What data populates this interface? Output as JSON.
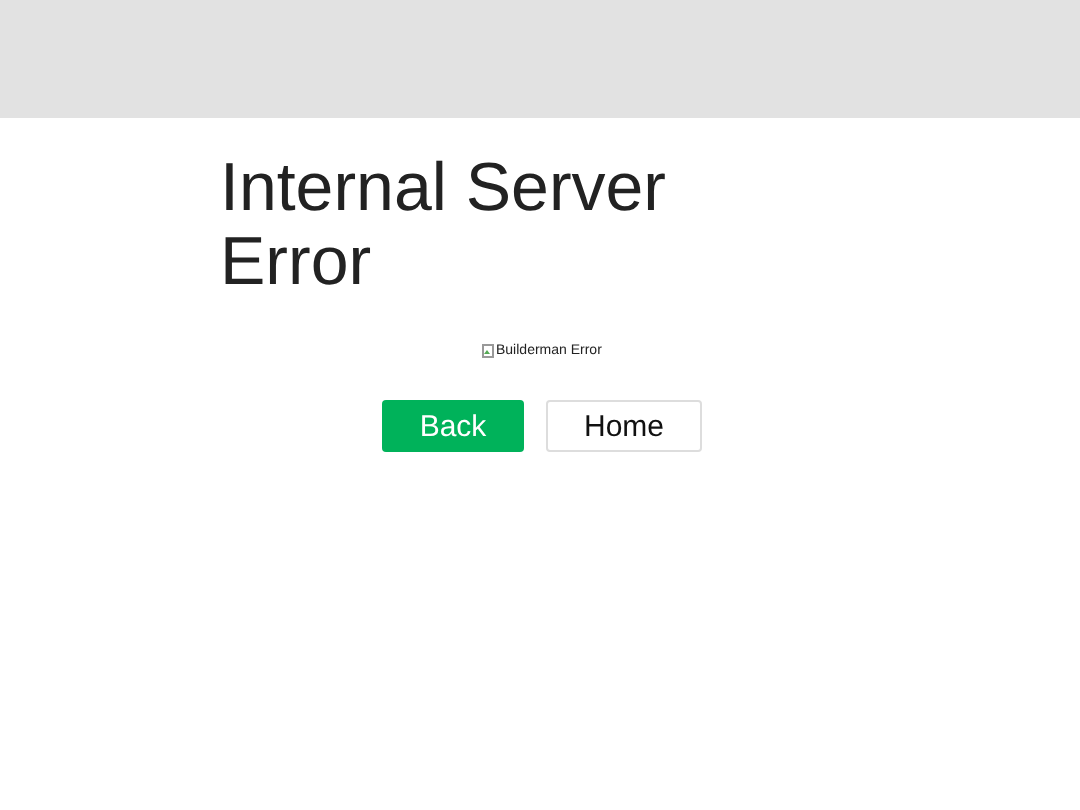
{
  "title": "Internal Server Error",
  "image": {
    "alt": "Builderman Error"
  },
  "buttons": [
    {
      "label": "Back",
      "kind": "primary"
    },
    {
      "label": "Home",
      "kind": "secondary"
    }
  ]
}
